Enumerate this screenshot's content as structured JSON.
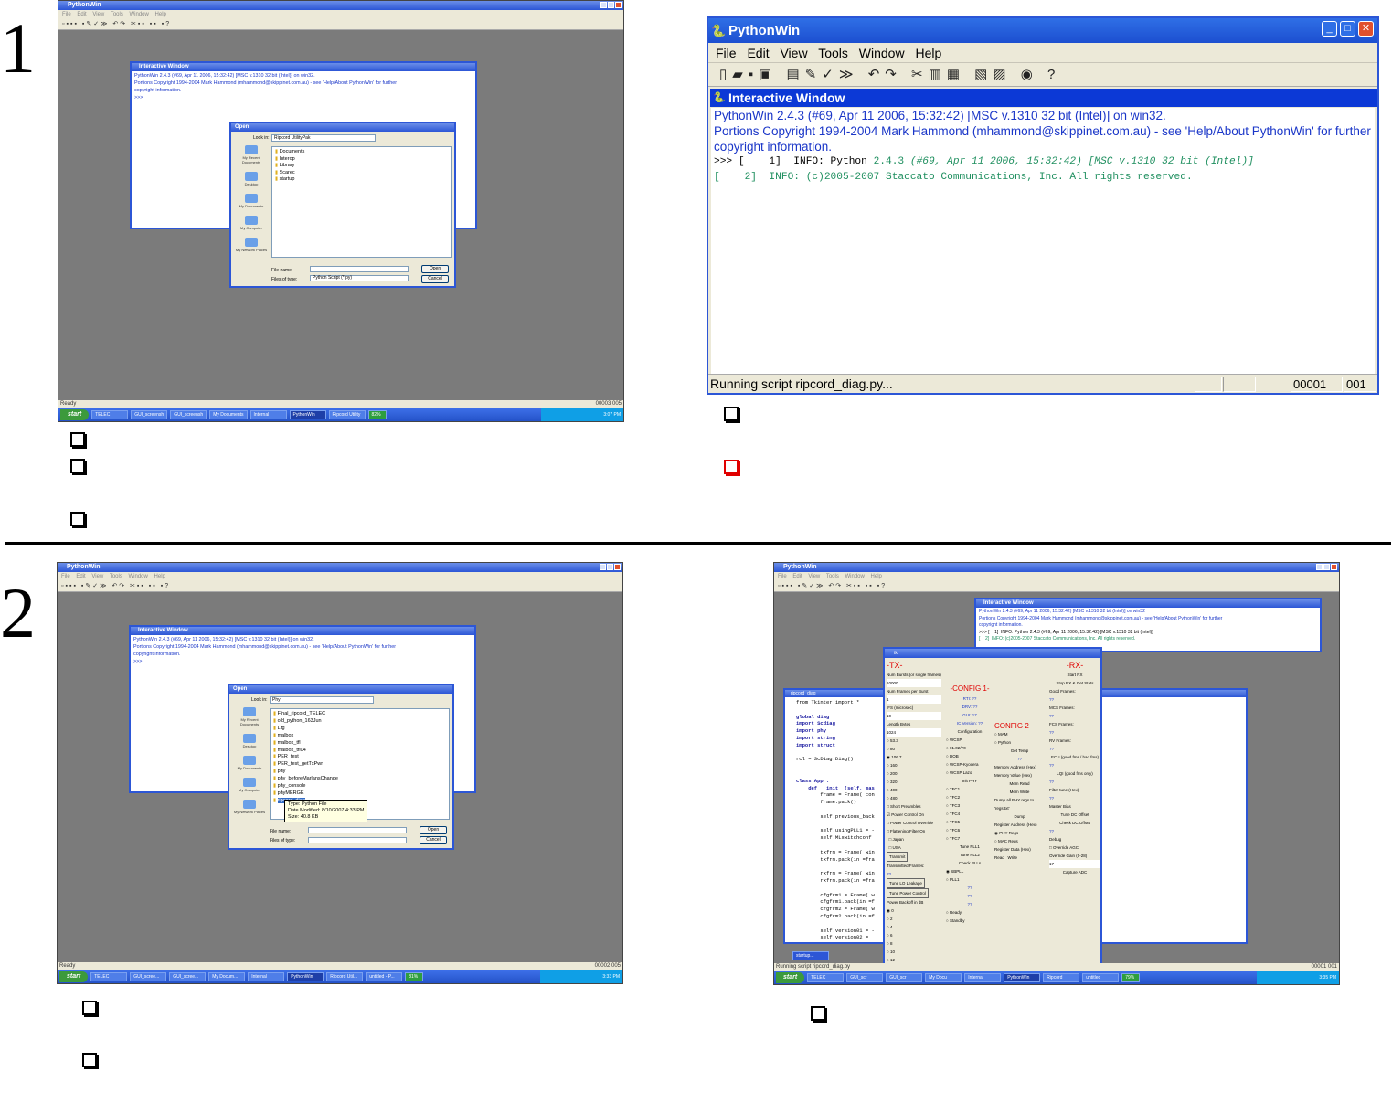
{
  "steps": [
    {
      "number": "1"
    },
    {
      "number": "2"
    }
  ],
  "panel1": {
    "app_title": "PythonWin",
    "menu": [
      "File",
      "Edit",
      "View",
      "Tools",
      "Window",
      "Help"
    ],
    "interactive_title": "Interactive Window",
    "interactive_text": [
      "PythonWin 2.4.3 (#69, Apr 11 2006, 15:32:42) [MSC v.1310 32 bit (Intel)] on win32.",
      "Portions Copyright 1994-2004 Mark Hammond (mhammond@skippinet.com.au) - see 'Help/About PythonWin' for further",
      "copyright information.",
      ">>>"
    ],
    "dialog": {
      "title": "Open",
      "look_in_label": "Look in:",
      "look_in_value": "Ripcord UtilityPak",
      "places": [
        "My Recent Documents",
        "Desktop",
        "My Documents",
        "My Computer",
        "My Network Places"
      ],
      "files": [
        "Documents",
        "Interop",
        "Library",
        "Scarec",
        "startup"
      ],
      "file_name_label": "File name:",
      "file_type_label": "Files of type:",
      "file_type_value": "Python Script (*.py)",
      "open_label": "Open",
      "cancel_label": "Cancel"
    },
    "status_left": "Ready",
    "status_right": "00003 005",
    "taskbar": {
      "start": "start",
      "items": [
        "TELEC",
        "GUI_screensh",
        "GUI_screensh",
        "My Documents",
        "Internal",
        "PythonWin",
        "Ripcord Utility"
      ],
      "battery": "82%",
      "clock": "3:07 PM"
    }
  },
  "panel2": {
    "title": "PythonWin",
    "menu": [
      "File",
      "Edit",
      "View",
      "Tools",
      "Window",
      "Help"
    ],
    "toolbar_icons": [
      "new-icon",
      "open-icon",
      "save-icon",
      "save-all-icon",
      "copy-icon",
      "wand-icon",
      "check-icon",
      "run-icon",
      "undo-icon",
      "redo-icon",
      "cut-icon",
      "copy2-icon",
      "paste-icon",
      "preview-icon",
      "print-icon",
      "web-icon",
      "help-icon"
    ],
    "interactive_title": "Interactive Window",
    "line1": "PythonWin 2.4.3 (#69, Apr 11 2006, 15:32:42) [MSC v.1310 32 bit (Intel)] on win32.",
    "line2": "Portions Copyright 1994-2004 Mark Hammond (mhammond@skippinet.com.au) - see 'Help/About PythonWin' for further",
    "line3": "copyright information.",
    "line4_prompt": ">>> [    1]  INFO: Python ",
    "line4_ver": "2.4.3",
    "line4_rest": " (#69, Apr 11 2006, 15:32:42) [MSC v.1310 32 bit (Intel)]",
    "line5": "[    2]  INFO: (c)2005-2007 Staccato Communications, Inc. All rights reserved.",
    "status": "Running script ripcord_diag.py...",
    "status_pos": "00001",
    "status_col": "001"
  },
  "panel3": {
    "app_title": "PythonWin",
    "interactive_title": "Interactive Window",
    "interactive_text": [
      "PythonWin 2.4.3 (#69, Apr 11 2006, 15:32:42) [MSC v.1310 32 bit (Intel)] on win32.",
      "Portions Copyright 1994-2004 Mark Hammond (mhammond@skippinet.com.au) - see 'Help/About PythonWin' for further",
      "copyright information.",
      ">>>"
    ],
    "dialog": {
      "title": "Open",
      "look_in_label": "Look in:",
      "look_in_value": "Phy",
      "places": [
        "My Recent Documents",
        "Desktop",
        "My Documents",
        "My Computer",
        "My Network Places"
      ],
      "files": [
        "Final_ripcord_TELEC",
        "old_python_163Jun",
        "Lrg",
        "malbox",
        "malbox_tfl",
        "malbox_tfl04",
        "PER_test",
        "PER_test_getTxPwr",
        "phy",
        "phy_beforeMarlansChange",
        "phy_console",
        "phyMERGE",
        "ripcord_diag"
      ],
      "tooltip": "Type: Python File\nDate Modified: 8/10/2007 4:33 PM\nSize: 40.8 KB",
      "file_name_label": "File name:",
      "file_type_label": "Files of type:",
      "open_label": "Open",
      "cancel_label": "Cancel"
    },
    "status_left": "Ready",
    "status_right": "00002 005",
    "taskbar": {
      "start": "start",
      "items": [
        "TELEC",
        "GUI_scree...",
        "GUI_scree...",
        "My Docum...",
        "Internal",
        "PythonWin",
        "Ripcord Util...",
        "untitled - P..."
      ],
      "battery": "81%",
      "clock": "3:33 PM"
    }
  },
  "panel4": {
    "app_title": "PythonWin",
    "interactive_title": "Interactive Window",
    "interactive_text": [
      "PythonWin 2.4.3 (#69, Apr 11 2006, 15:32:42) [MSC v.1310 32 bit (Intel)] on win32",
      "Portions Copyright 1994-2004 Mark Hammond (mhammond@skippinet.com.au) - see 'Help/About PythonWin' for further",
      "copyright information.",
      ">>> [    1]  INFO: Python 2.4.3 (#69, Apr 11 2006, 15:32:42) [MSC v.1310 32 bit (Intel)]",
      "[    2]  INFO: (c)2005-2007 Staccato Communications, Inc. All rights reserved."
    ],
    "code_title": "ripcord_diag",
    "code": [
      "from Tkinter import *",
      "",
      "global diag",
      "import Scdiag",
      "import phy",
      "import string",
      "import struct",
      "",
      "rcl = ScDiag.Diag()",
      "",
      "",
      "class App :",
      "    def __init__(self, mas",
      "        frame = Frame( con",
      "        frame.pack()",
      "",
      "        self.previous_back",
      "",
      "        self.usingPLL1 = -",
      "        self.MLswitchconf",
      "",
      "        txfrm = Frame( win",
      "        txfrm.pack(in =fra",
      "",
      "        rxfrm = Frame( win",
      "        rxfrm.pack(in =fra",
      "",
      "        cfgfrm1 = Frame( w",
      "        cfgfrm1.pack(in =f",
      "        cfgfrm2 = Frame( w",
      "        cfgfrm2.pack(in =f",
      "",
      "        self.version01 = -",
      "        self.version02 ="
    ],
    "tk_title": "tk",
    "tx": {
      "header": "-TX-",
      "fields": [
        "Num Bursts (or single frames)",
        "10000",
        "Num Frames per Burst",
        "1",
        "IFS (microsec)",
        "10",
        "Length Bytes",
        "1024"
      ],
      "rates": [
        "53.3",
        "80",
        "106.7",
        "160",
        "200",
        "320",
        "400",
        "480"
      ],
      "checks": [
        "Short Preambles",
        "Power Control On",
        "Power Control Override",
        "Flattening Filter On",
        "Japan",
        "USA"
      ],
      "transmit": "Transmit",
      "transmitted_label": "Transmitted Frames:",
      "transmitted_value": "??",
      "tune_lo": "Tune LO Leakage",
      "tune_power": "Tune Power Control",
      "backoff_label": "Power Backoff in dB",
      "backoff": [
        "0",
        "2",
        "4",
        "6",
        "8",
        "10",
        "12"
      ]
    },
    "config1": {
      "header": "-CONFIG 1-",
      "rows": [
        "RTI:  ??",
        "DRV:  ??",
        "GUI:  17",
        "IC Version:  ??"
      ],
      "config_label": "Configuration",
      "options": [
        "WCSP",
        "01.02/T0",
        "DOB",
        "WCSP-Kyocera",
        "WCSP Lazo"
      ],
      "init_phy": "Init PHY",
      "tfc": [
        "TFC1",
        "TFC2",
        "TFC3",
        "TFC4",
        "TFC5",
        "TFC6",
        "TFC7"
      ],
      "tune": [
        "Tune PLL1",
        "Tune PLL2",
        "Check PLLs"
      ],
      "pll": [
        "SBPLL",
        "PLL1"
      ],
      "qq": [
        "??",
        "??",
        "??"
      ],
      "ready": [
        "Ready",
        "Standby"
      ]
    },
    "config2": {
      "header": "CONFIG 2",
      "options": [
        "MAM",
        "Python"
      ],
      "get_temp": "Get Temp",
      "temp": "??",
      "mem_addr": "Memory Address (Hex)",
      "mem_val": "Memory Value (Hex)",
      "mem_read": "Mem Read",
      "mem_write": "Mem Write",
      "dump_label": "Dump all PHY regs to 'regs.txt'",
      "dump": "Dump",
      "reg_addr": "Register Address (Hex)",
      "phy_regs": "PHY Regs",
      "mac_regs": "MAC Regs",
      "reg_data": "Register Data (Hex)",
      "read": "Read",
      "write": "Write"
    },
    "rx": {
      "header": "-RX-",
      "start": "Start RX",
      "stop": "Stop RX & Get Stats",
      "good_label": "Good Frames:",
      "mcs_label": "MCS Frames:",
      "fcs_label": "FCS Frames:",
      "rv_label": "RV Frames:",
      "qq": "??",
      "ecu": "ECU (good fms / bad fms)",
      "lqi": "LQI (good fms only)",
      "filter_label": "Filter tune (Hex)",
      "master_bias": "Master Bias",
      "tune_dc": "Tune DC Offset",
      "check_dc": "Check DC Offset",
      "debug": "Debug",
      "override_agc": "Override AGC",
      "override_gain": "Override Gain (0-28)",
      "gain": "17",
      "capture": "Capture ADC"
    },
    "status_left": "Running script ripcord_diag.py",
    "status_right": "00001 001",
    "minimized": "startup...",
    "taskbar": {
      "start": "start",
      "items": [
        "TELEC",
        "GUI_scr",
        "GUI_scr",
        "My Docu",
        "Internal",
        "PythonWin",
        "Ripcord",
        "untitled"
      ],
      "battery": "79%",
      "clock": "3:35 PM"
    }
  },
  "checkboxes": {
    "colors": {
      "normal": "#000000",
      "highlight": "#e00000"
    }
  }
}
